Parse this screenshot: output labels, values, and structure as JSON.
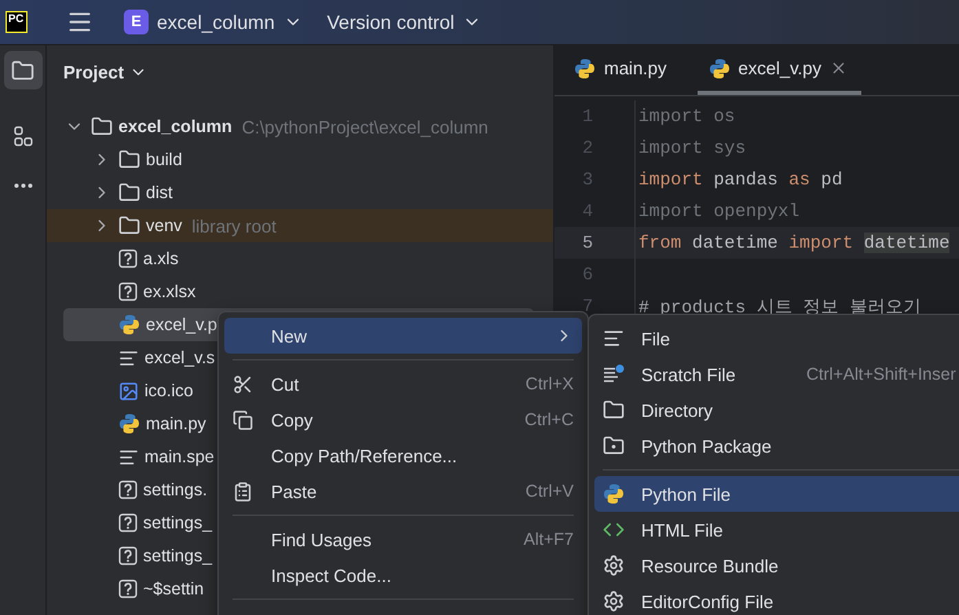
{
  "header": {
    "logo": "PC",
    "project_badge": "E",
    "project": "excel_column",
    "vcs": "Version control"
  },
  "project_panel": {
    "title": "Project",
    "tree": [
      {
        "name": "excel_column",
        "note": "C:\\pythonProject\\excel_column",
        "kind": "folder",
        "expanded": true,
        "selected": false,
        "library": false,
        "children": [
          {
            "name": "build",
            "kind": "folder",
            "expanded": false,
            "selected": false,
            "library": false
          },
          {
            "name": "dist",
            "kind": "folder",
            "expanded": false,
            "selected": false,
            "library": false
          },
          {
            "name": "venv",
            "note": "library root",
            "kind": "folder",
            "expanded": false,
            "selected": false,
            "library": true
          },
          {
            "name": "a.xls",
            "kind": "unknown",
            "selected": false,
            "library": false
          },
          {
            "name": "ex.xlsx",
            "kind": "unknown",
            "selected": false,
            "library": false
          },
          {
            "name": "excel_v.p",
            "kind": "python",
            "selected": true,
            "library": false
          },
          {
            "name": "excel_v.s",
            "kind": "text",
            "selected": false,
            "library": false
          },
          {
            "name": "ico.ico",
            "kind": "image",
            "selected": false,
            "library": false
          },
          {
            "name": "main.py",
            "kind": "python",
            "selected": false,
            "library": false
          },
          {
            "name": "main.spe",
            "kind": "text",
            "selected": false,
            "library": false
          },
          {
            "name": "settings.",
            "kind": "unknown",
            "selected": false,
            "library": false
          },
          {
            "name": "settings_",
            "kind": "unknown",
            "selected": false,
            "library": false
          },
          {
            "name": "settings_",
            "kind": "unknown",
            "selected": false,
            "library": false
          },
          {
            "name": "~$settin",
            "kind": "unknown",
            "selected": false,
            "library": false
          }
        ]
      }
    ]
  },
  "editor": {
    "tabs": [
      {
        "label": "main.py",
        "selected": false
      },
      {
        "label": "excel_v.py",
        "selected": true
      }
    ],
    "lines": [
      {
        "number": "1",
        "current": false,
        "tokens": [
          {
            "text": "import os",
            "kind": "unused"
          }
        ]
      },
      {
        "number": "2",
        "current": false,
        "tokens": [
          {
            "text": "import sys",
            "kind": "unused"
          }
        ]
      },
      {
        "number": "3",
        "current": false,
        "tokens": [
          {
            "text": "import",
            "kind": "keyword"
          },
          {
            "text": " pandas ",
            "kind": "plain"
          },
          {
            "text": "as",
            "kind": "keyword"
          },
          {
            "text": " pd",
            "kind": "plain"
          }
        ]
      },
      {
        "number": "4",
        "current": false,
        "tokens": [
          {
            "text": "import openpyxl",
            "kind": "unused"
          }
        ]
      },
      {
        "number": "5",
        "current": true,
        "tokens": [
          {
            "text": "from",
            "kind": "keyword"
          },
          {
            "text": " datetime ",
            "kind": "plain"
          },
          {
            "text": "import ",
            "kind": "keyword"
          },
          {
            "text": "datetime",
            "kind": "highlight"
          }
        ]
      },
      {
        "number": "6",
        "current": false
      },
      {
        "number": "7",
        "current": false,
        "tokens": [
          {
            "text": "# products 시트 정보 ",
            "kind": "comment"
          },
          {
            "text": "불러오기",
            "kind": "typo"
          }
        ]
      }
    ]
  },
  "context_menu": {
    "items": [
      {
        "kind": "submenu",
        "label": "New",
        "selected": true
      },
      {
        "kind": "separator"
      },
      {
        "kind": "cut",
        "label": "Cut",
        "shortcut": "Ctrl+X",
        "selected": false
      },
      {
        "kind": "copy",
        "label": "Copy",
        "shortcut": "Ctrl+C",
        "selected": false
      },
      {
        "kind": "plain",
        "label": "Copy Path/Reference...",
        "selected": false
      },
      {
        "kind": "paste",
        "label": "Paste",
        "shortcut": "Ctrl+V",
        "selected": false
      },
      {
        "kind": "separator"
      },
      {
        "kind": "plain",
        "label": "Find Usages",
        "shortcut": "Alt+F7",
        "selected": false
      },
      {
        "kind": "plain",
        "label": "Inspect Code...",
        "selected": false
      },
      {
        "kind": "separator"
      }
    ]
  },
  "new_submenu": {
    "items": [
      {
        "kind": "file",
        "label": "File",
        "selected": false
      },
      {
        "kind": "scratch",
        "label": "Scratch File",
        "shortcut": "Ctrl+Alt+Shift+Inser",
        "selected": false
      },
      {
        "kind": "folder",
        "label": "Directory",
        "selected": false
      },
      {
        "kind": "package",
        "label": "Python Package",
        "selected": false
      },
      {
        "kind": "separator"
      },
      {
        "kind": "python",
        "label": "Python File",
        "selected": true
      },
      {
        "kind": "html",
        "label": "HTML File",
        "selected": false
      },
      {
        "kind": "gear",
        "label": "Resource Bundle",
        "selected": false
      },
      {
        "kind": "gear",
        "label": "EditorConfig File",
        "selected": false
      }
    ]
  }
}
